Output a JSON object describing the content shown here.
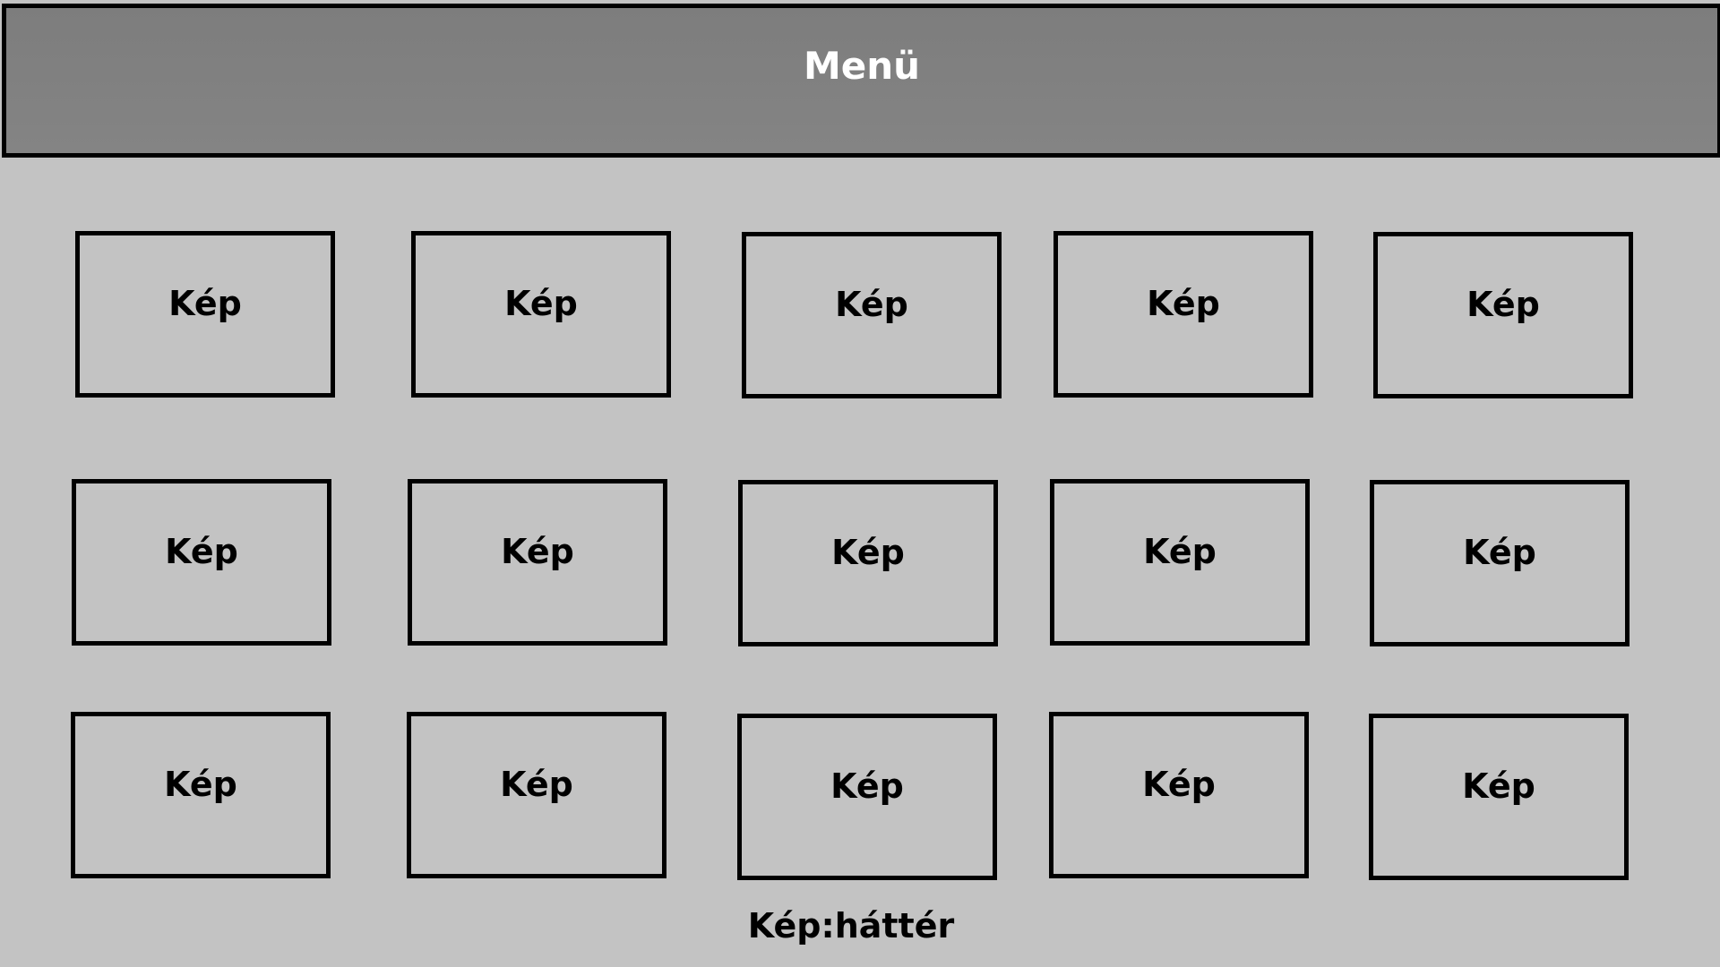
{
  "header": {
    "title": "Menü"
  },
  "grid": {
    "tiles": [
      {
        "label": "Kép"
      },
      {
        "label": "Kép"
      },
      {
        "label": "Kép"
      },
      {
        "label": "Kép"
      },
      {
        "label": "Kép"
      },
      {
        "label": "Kép"
      },
      {
        "label": "Kép"
      },
      {
        "label": "Kép"
      },
      {
        "label": "Kép"
      },
      {
        "label": "Kép"
      },
      {
        "label": "Kép"
      },
      {
        "label": "Kép"
      },
      {
        "label": "Kép"
      },
      {
        "label": "Kép"
      },
      {
        "label": "Kép"
      }
    ]
  },
  "footer": {
    "caption": "Kép:háttér"
  },
  "colors": {
    "background": "#c3c3c3",
    "menu_bar": "#808080",
    "border": "#000000",
    "menu_text": "#ffffff"
  }
}
